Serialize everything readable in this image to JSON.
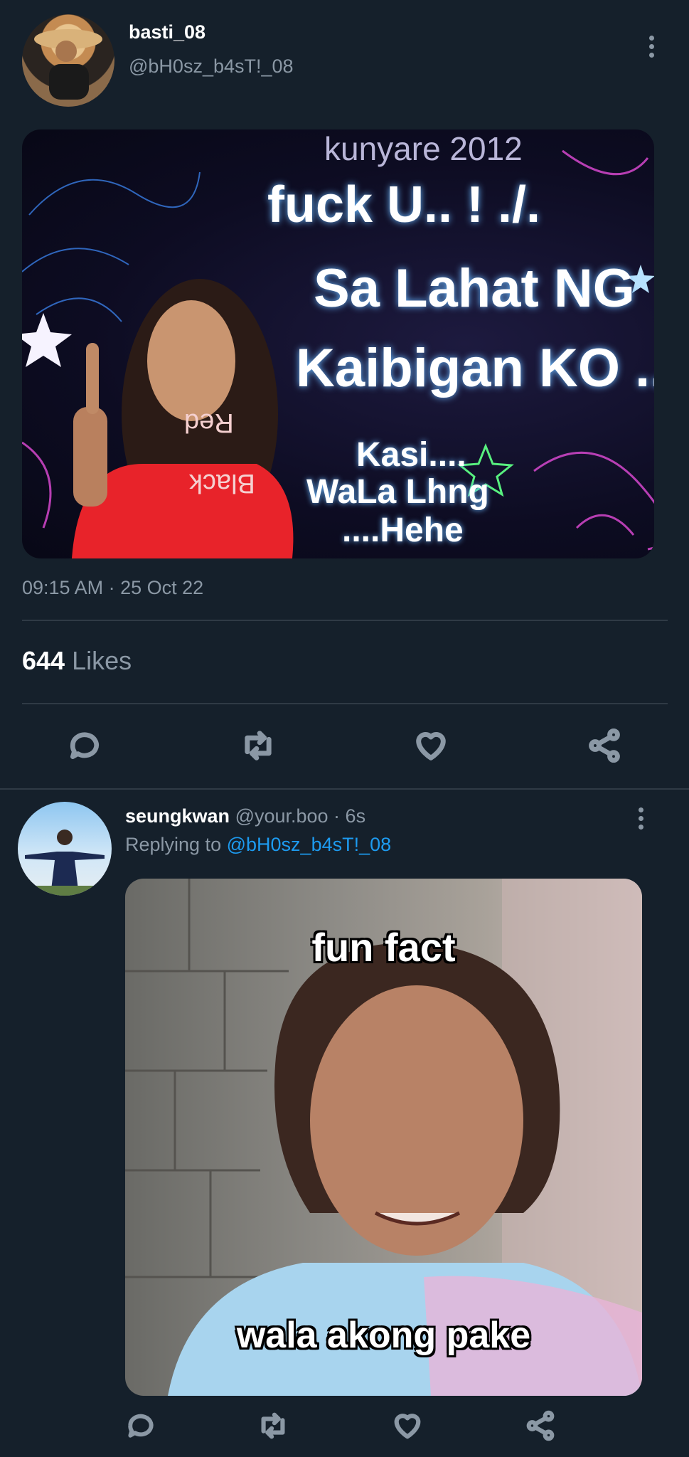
{
  "tweet": {
    "display_name": "basti_08",
    "handle": "@bH0sz_b4sT!_08",
    "image": {
      "line1": "kunyare 2012",
      "line2": "fuck U.. ! ./.",
      "line3": "Sa Lahat NG",
      "line4": "Kaibigan KO ..",
      "line5": "Kasi....",
      "line6": "WaLa Lhng",
      "line7": "....Hehe",
      "shirt_text1": "Red",
      "shirt_text2": "Black"
    },
    "timestamp": "09:15 AM · 25 Oct 22",
    "likes_count": "644",
    "likes_label": "Likes",
    "icons": [
      "reply-icon",
      "retweet-icon",
      "like-icon",
      "share-icon"
    ]
  },
  "reply": {
    "display_name": "seungkwan",
    "handle_time": "@your.boo · 6s",
    "replying_prefix": "Replying to",
    "replying_handle": "@bH0sz_b4sT!_08",
    "image": {
      "top_caption": "fun fact",
      "bottom_caption": "wala akong pake"
    },
    "icons": [
      "reply-icon",
      "retweet-icon",
      "like-icon",
      "share-icon"
    ]
  },
  "colors": {
    "background": "#15202b",
    "muted": "#8b98a5",
    "link": "#1d9bf0",
    "divider": "#2f3a45"
  }
}
